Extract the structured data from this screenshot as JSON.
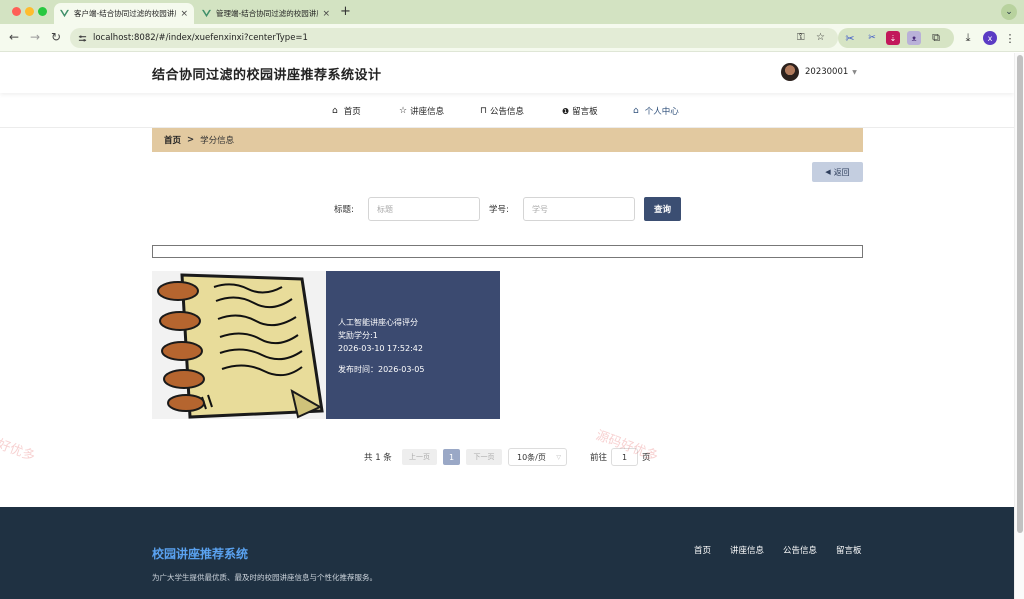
{
  "browser": {
    "tabs": [
      {
        "title": "客户端-结合协同过滤的校园讲座",
        "active": true
      },
      {
        "title": "管理端-结合协同过滤的校园讲座",
        "active": false
      }
    ],
    "url": "localhost:8082/#/index/xuefenxinxi?centerType=1",
    "profile_initial": "x"
  },
  "header": {
    "title": "结合协同过滤的校园讲座推荐系统设计",
    "username": "20230001"
  },
  "menu": [
    {
      "icon": "house-icon",
      "label": "首页"
    },
    {
      "icon": "star-icon",
      "label": "讲座信息"
    },
    {
      "icon": "bag-icon",
      "label": "公告信息"
    },
    {
      "icon": "info-icon",
      "label": "留言板"
    },
    {
      "icon": "home-outline-icon",
      "label": "个人中心"
    }
  ],
  "breadcrumb": {
    "home": "首页",
    "separator": ">",
    "current": "学分信息"
  },
  "back_label": "返回",
  "search": {
    "title_label": "标题:",
    "title_placeholder": "标题",
    "student_label": "学号:",
    "student_placeholder": "学号",
    "query_label": "查询"
  },
  "card": {
    "title": "人工智能讲座心得评分",
    "credit": "奖励学分:1",
    "datetime": "2026-03-10 17:52:42",
    "publish": "发布时间：2026-03-05"
  },
  "pagination": {
    "total": "共 1 条",
    "prev": "上一页",
    "page": "1",
    "next": "下一页",
    "size": "10条/页",
    "goto": "前往",
    "goto_value": "1",
    "unit": "页"
  },
  "footer": {
    "title": "校园讲座推荐系统",
    "desc": "为广大学生提供最优质、最及时的校园讲座信息与个性化推荐服务。",
    "links": [
      "首页",
      "讲座信息",
      "公告信息",
      "留言板"
    ]
  },
  "watermark": "源码好优多",
  "colors": {
    "accent": "#3b4a70",
    "breadcrumb_bg": "#e2c9a0",
    "footer_bg": "#1f3142",
    "footer_title": "#5aa2f0"
  }
}
